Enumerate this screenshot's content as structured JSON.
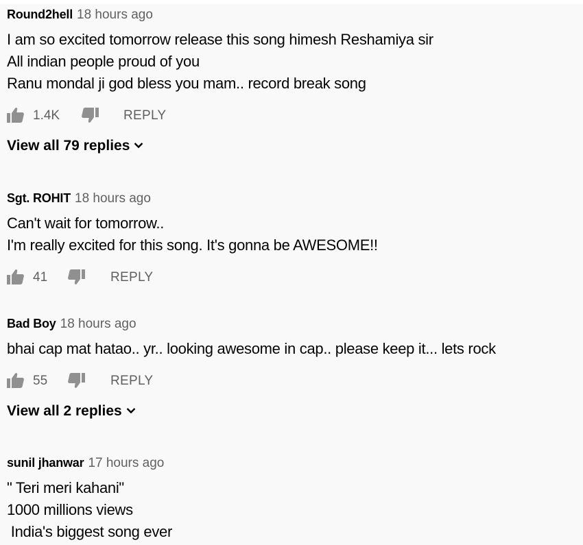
{
  "comments": [
    {
      "author": "Round2hell",
      "time": "18 hours ago",
      "lines": [
        "I am so excited tomorrow release this song himesh Reshamiya sir",
        "All indian people proud of you",
        "Ranu mondal ji god bless you mam.. record break song"
      ],
      "likes": "1.4K",
      "reply_label": "REPLY",
      "view_replies": "View all 79 replies"
    },
    {
      "author": "Sgt. ROHIT",
      "time": "18 hours ago",
      "lines": [
        "Can't wait for tomorrow..",
        "I'm really excited for this song. It's gonna be AWESOME!!"
      ],
      "likes": "41",
      "reply_label": "REPLY"
    },
    {
      "author": "Bad Boy",
      "time": "18 hours ago",
      "lines": [
        "bhai cap mat hatao.. yr.. looking awesome in cap.. please keep it... lets rock"
      ],
      "likes": "55",
      "reply_label": "REPLY",
      "view_replies": "View all 2 replies"
    },
    {
      "author": "sunil jhanwar",
      "time": "17 hours ago",
      "lines": [
        "\" Teri meri kahani\"",
        "1000 millions views",
        " India's biggest song ever"
      ]
    }
  ],
  "icons": {
    "like": "thumb-up-icon",
    "dislike": "thumb-down-icon",
    "expand": "chevron-down-icon"
  },
  "colors": {
    "background": "#f9f9f9",
    "primary_text": "#030303",
    "secondary_text": "#606060"
  }
}
